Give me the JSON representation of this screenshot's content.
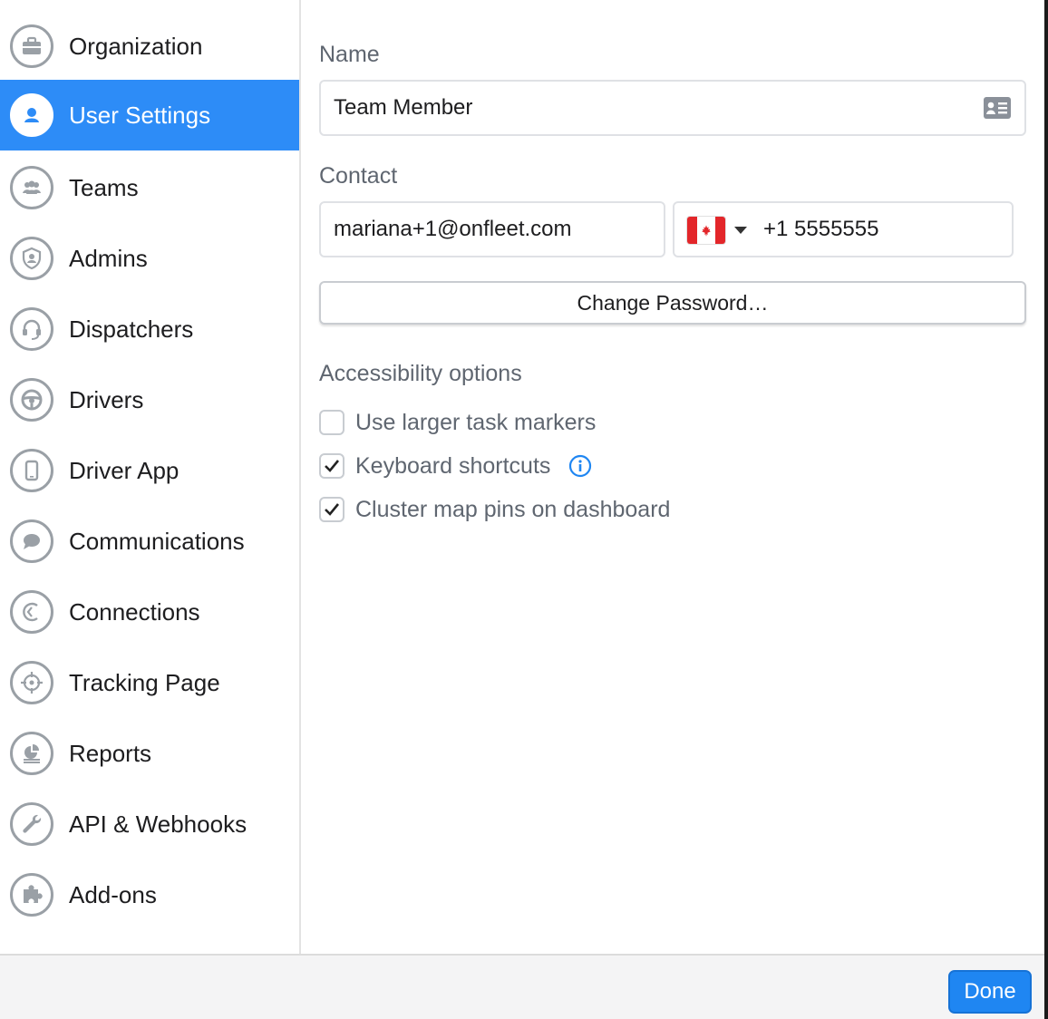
{
  "sidebar": {
    "items": [
      {
        "label": "Organization",
        "icon": "briefcase-icon"
      },
      {
        "label": "User Settings",
        "icon": "user-icon",
        "active": true
      },
      {
        "label": "Teams",
        "icon": "team-icon"
      },
      {
        "label": "Admins",
        "icon": "shield-icon"
      },
      {
        "label": "Dispatchers",
        "icon": "headset-icon"
      },
      {
        "label": "Drivers",
        "icon": "steering-wheel-icon"
      },
      {
        "label": "Driver App",
        "icon": "phone-icon"
      },
      {
        "label": "Communications",
        "icon": "chat-bubble-icon"
      },
      {
        "label": "Connections",
        "icon": "connections-icon"
      },
      {
        "label": "Tracking Page",
        "icon": "crosshair-icon"
      },
      {
        "label": "Reports",
        "icon": "report-icon"
      },
      {
        "label": "API & Webhooks",
        "icon": "wrench-icon"
      },
      {
        "label": "Add-ons",
        "icon": "puzzle-icon"
      }
    ]
  },
  "main": {
    "name_label": "Name",
    "name_value": "Team Member",
    "contact_label": "Contact",
    "email_value": "mariana+1@onfleet.com",
    "phone_value": "+1 5555555",
    "country_flag": "CA",
    "change_password_label": "Change Password…",
    "accessibility_label": "Accessibility options",
    "options": [
      {
        "label": "Use larger task markers",
        "checked": false
      },
      {
        "label": "Keyboard shortcuts",
        "checked": true,
        "info": true
      },
      {
        "label": "Cluster map pins on dashboard",
        "checked": true
      }
    ]
  },
  "footer": {
    "done_label": "Done"
  },
  "colors": {
    "accent": "#2d8cf7",
    "done_button": "#1f86f2",
    "icon_gray": "#9aa0a6",
    "label_gray": "#5f6670"
  }
}
